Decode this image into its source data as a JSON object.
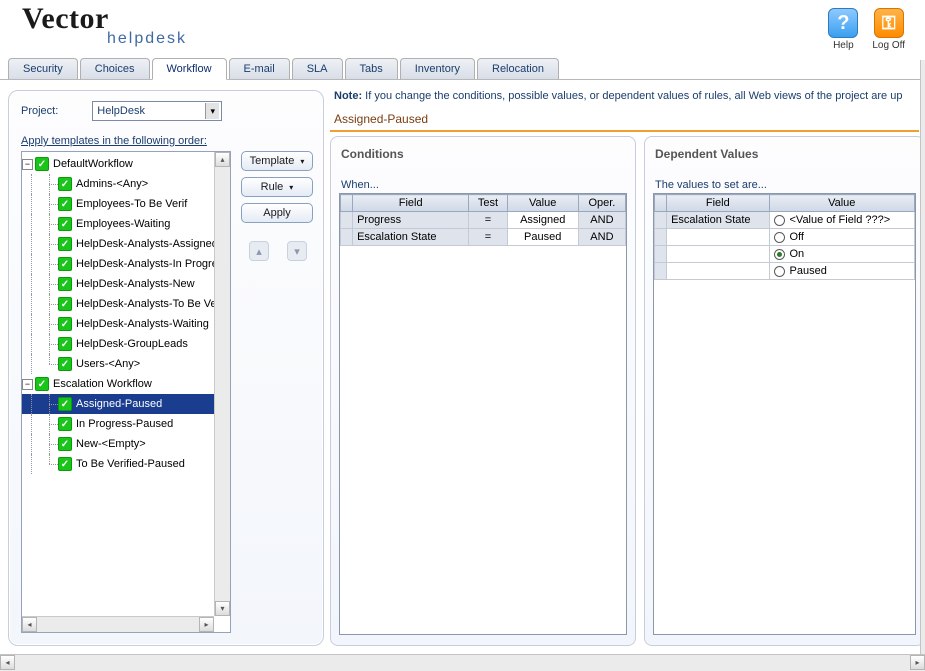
{
  "brand": {
    "name": "Vector",
    "sub": "helpdesk"
  },
  "header": {
    "help": "Help",
    "logoff": "Log Off"
  },
  "tabs": [
    "Security",
    "Choices",
    "Workflow",
    "E-mail",
    "SLA",
    "Tabs",
    "Inventory",
    "Relocation"
  ],
  "active_tab": 2,
  "project": {
    "label": "Project:",
    "value": "HelpDesk"
  },
  "apply_label": "Apply templates in the following order:",
  "buttons": {
    "template": "Template",
    "rule": "Rule",
    "apply": "Apply"
  },
  "tree": [
    {
      "level": 0,
      "pm": "-",
      "label": "DefaultWorkflow",
      "selected": false
    },
    {
      "level": 1,
      "pm": "",
      "label": "Admins-<Any>"
    },
    {
      "level": 1,
      "pm": "",
      "label": "Employees-To Be Verif"
    },
    {
      "level": 1,
      "pm": "",
      "label": "Employees-Waiting"
    },
    {
      "level": 1,
      "pm": "",
      "label": "HelpDesk-Analysts-Assigned"
    },
    {
      "level": 1,
      "pm": "",
      "label": "HelpDesk-Analysts-In Progress"
    },
    {
      "level": 1,
      "pm": "",
      "label": "HelpDesk-Analysts-New"
    },
    {
      "level": 1,
      "pm": "",
      "label": "HelpDesk-Analysts-To Be Verified"
    },
    {
      "level": 1,
      "pm": "",
      "label": "HelpDesk-Analysts-Waiting"
    },
    {
      "level": 1,
      "pm": "",
      "label": "HelpDesk-GroupLeads"
    },
    {
      "level": 1,
      "pm": "",
      "label": "Users-<Any>",
      "last": true
    },
    {
      "level": 0,
      "pm": "-",
      "label": "Escalation Workflow"
    },
    {
      "level": 1,
      "pm": "",
      "label": "Assigned-Paused",
      "selected": true
    },
    {
      "level": 1,
      "pm": "",
      "label": "In Progress-Paused"
    },
    {
      "level": 1,
      "pm": "",
      "label": "New-<Empty>"
    },
    {
      "level": 1,
      "pm": "",
      "label": "To Be Verified-Paused",
      "last": true
    }
  ],
  "note_prefix": "Note:",
  "note_text": " If you change the conditions, possible values, or dependent values of rules, all Web views of the project are up",
  "rule_title": "Assigned-Paused",
  "conditions": {
    "title": "Conditions",
    "subtitle": "When...",
    "headers": [
      "Field",
      "Test",
      "Value",
      "Oper."
    ],
    "rows": [
      {
        "field": "Progress",
        "test": "=",
        "value": "Assigned",
        "op": "AND"
      },
      {
        "field": "Escalation State",
        "test": "=",
        "value": "Paused",
        "op": "AND"
      }
    ]
  },
  "dependent": {
    "title": "Dependent Values",
    "subtitle": "The values to set are...",
    "headers": [
      "Field",
      "Value"
    ],
    "field": "Escalation State",
    "options": [
      {
        "label": "<Value of Field ???>",
        "selected": false
      },
      {
        "label": "Off",
        "selected": false
      },
      {
        "label": "On",
        "selected": true
      },
      {
        "label": "Paused",
        "selected": false
      }
    ]
  }
}
